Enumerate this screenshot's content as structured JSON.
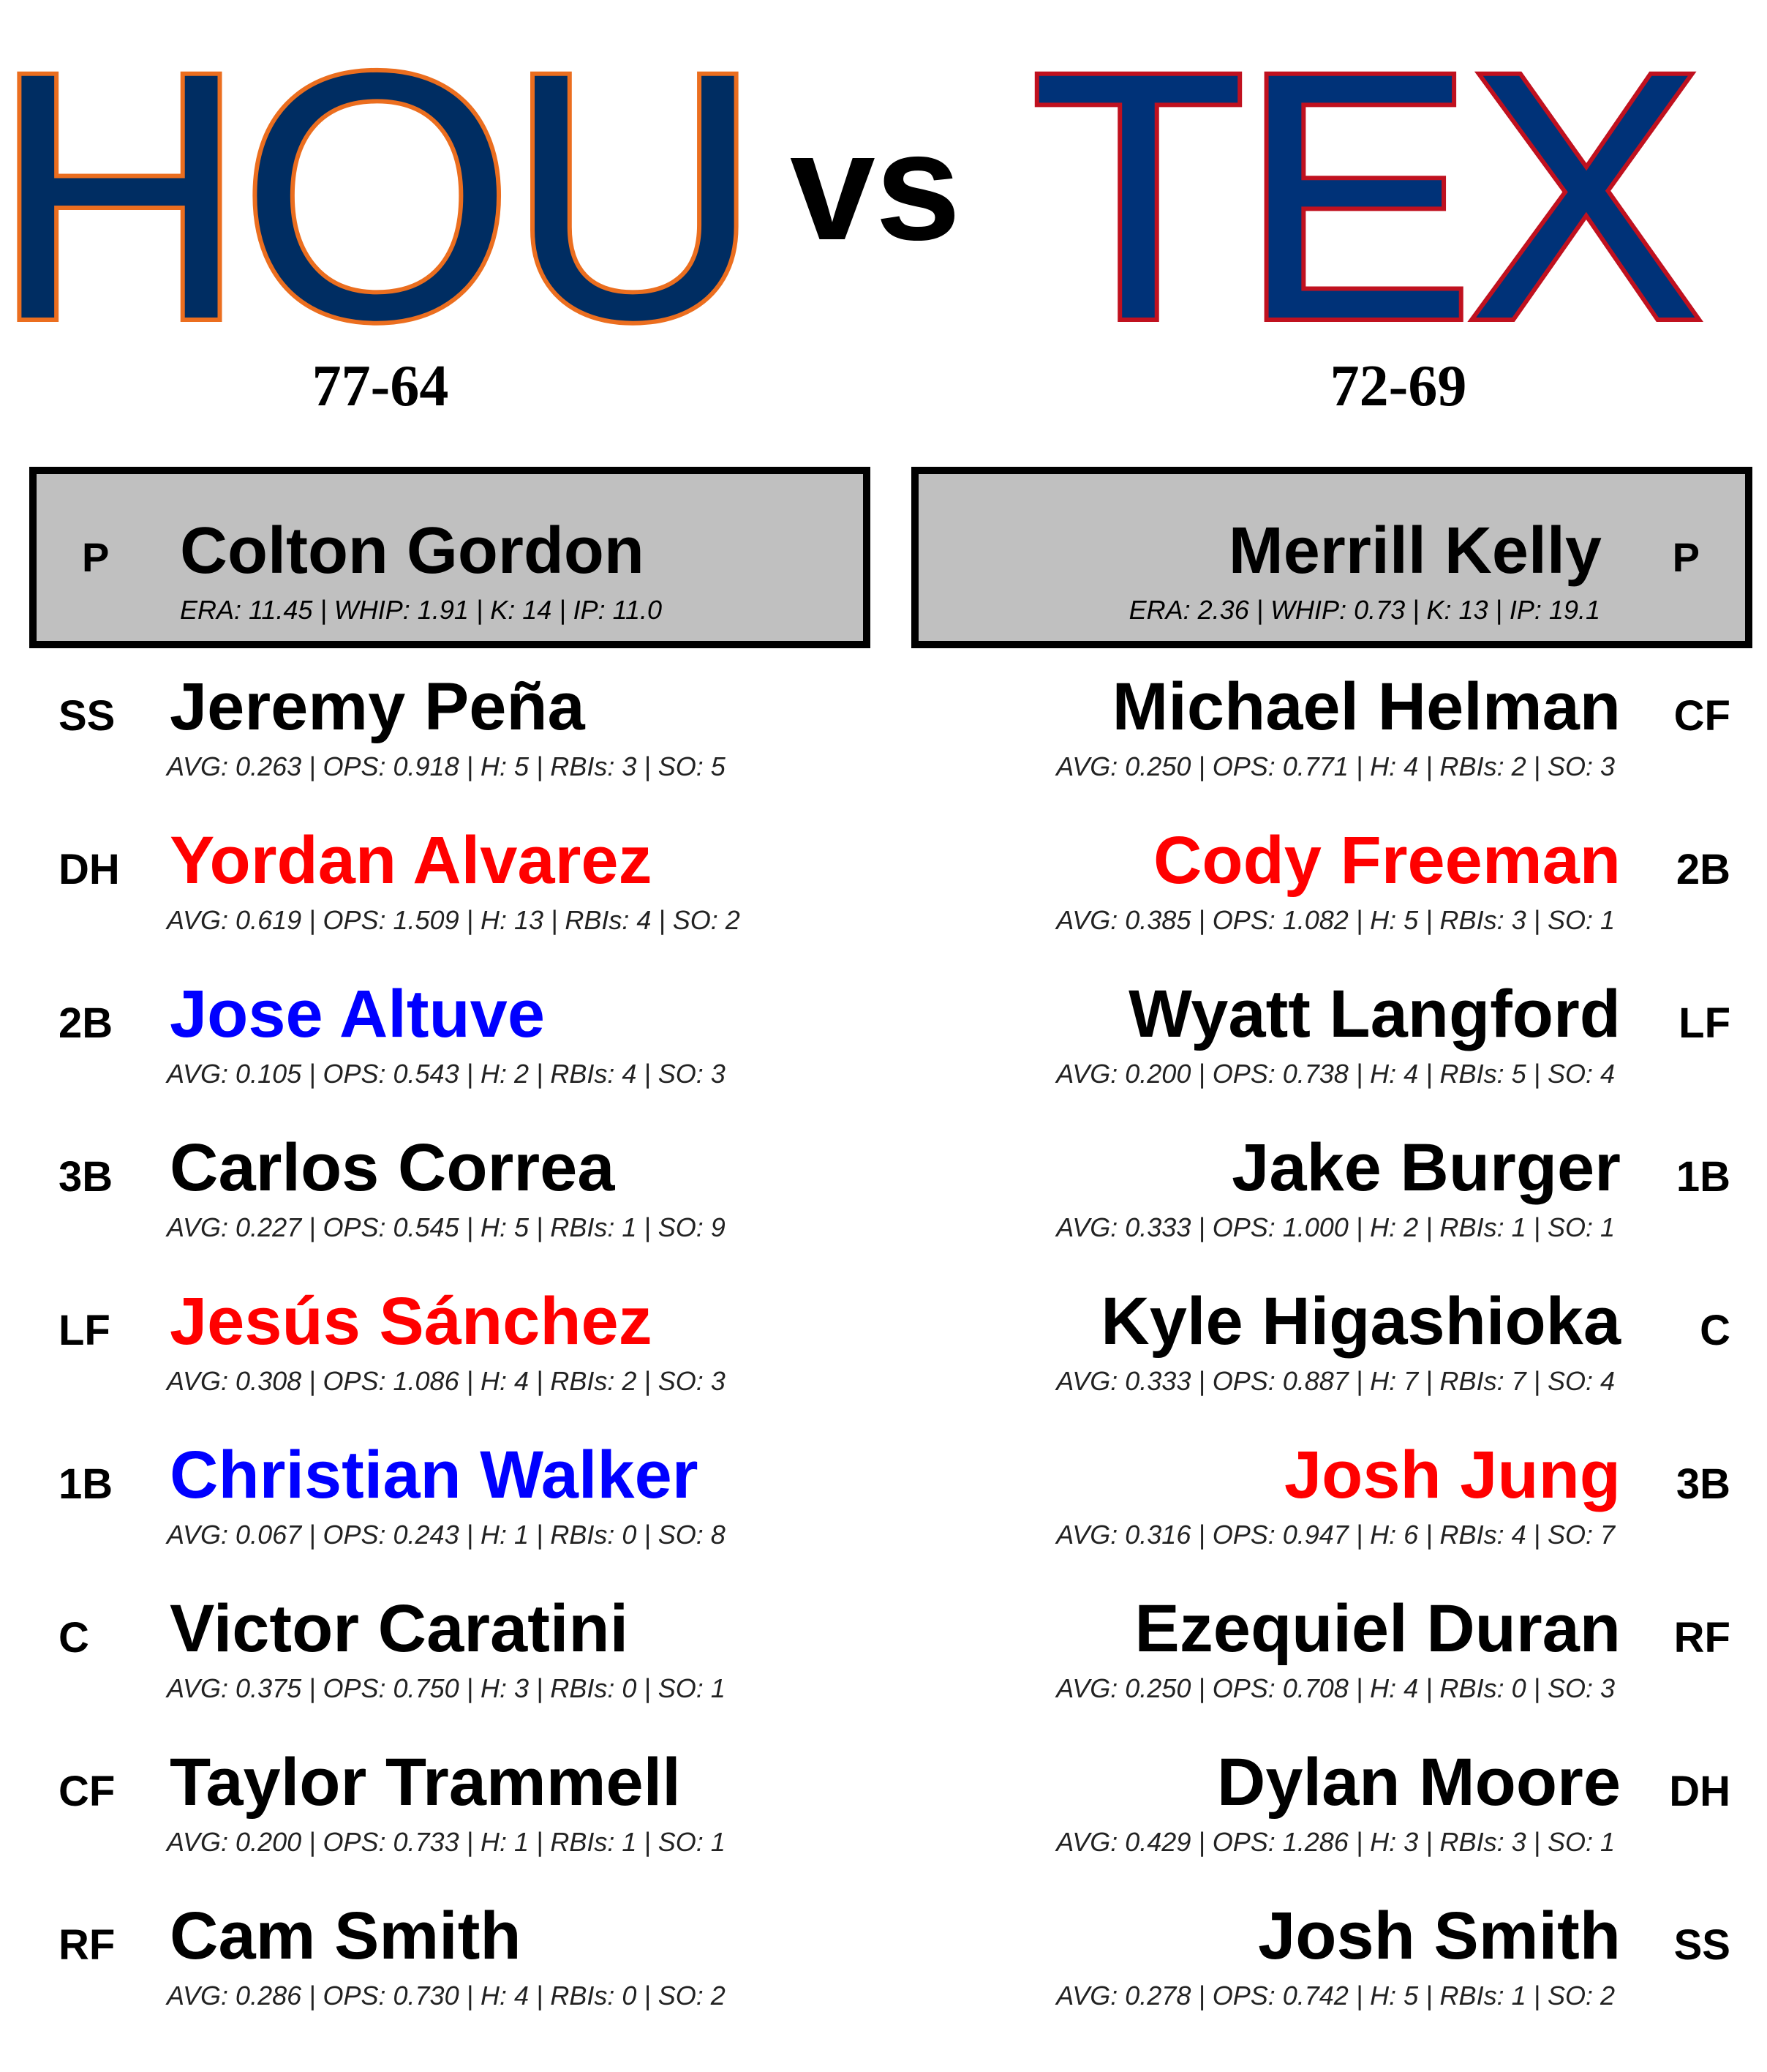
{
  "home": {
    "code": "HOU",
    "record": "77-64",
    "colors": {
      "fill": "#002D62",
      "stroke": "#EB6E1F"
    },
    "pitcher": {
      "pos": "P",
      "name": "Colton Gordon",
      "stats": "ERA: 11.45 | WHIP: 1.91 | K: 14 | IP: 11.0"
    },
    "lineup": [
      {
        "pos": "SS",
        "name": "Jeremy Peña",
        "color": "#000000",
        "stats": "AVG: 0.263 | OPS: 0.918 | H: 5 | RBIs: 3 | SO: 5"
      },
      {
        "pos": "DH",
        "name": "Yordan Alvarez",
        "color": "#ff0000",
        "stats": "AVG: 0.619 | OPS: 1.509 | H: 13 | RBIs: 4 | SO: 2"
      },
      {
        "pos": "2B",
        "name": "Jose Altuve",
        "color": "#0000ff",
        "stats": "AVG: 0.105 | OPS: 0.543 | H: 2 | RBIs: 4 | SO: 3"
      },
      {
        "pos": "3B",
        "name": "Carlos Correa",
        "color": "#000000",
        "stats": "AVG: 0.227 | OPS: 0.545 | H: 5 | RBIs: 1 | SO: 9"
      },
      {
        "pos": "LF",
        "name": "Jesús Sánchez",
        "color": "#ff0000",
        "stats": "AVG: 0.308 | OPS: 1.086 | H: 4 | RBIs: 2 | SO: 3"
      },
      {
        "pos": "1B",
        "name": "Christian Walker",
        "color": "#0000ff",
        "stats": "AVG: 0.067 | OPS: 0.243 | H: 1 | RBIs: 0 | SO: 8"
      },
      {
        "pos": "C",
        "name": "Victor Caratini",
        "color": "#000000",
        "stats": "AVG: 0.375 | OPS: 0.750 | H: 3 | RBIs: 0 | SO: 1"
      },
      {
        "pos": "CF",
        "name": "Taylor Trammell",
        "color": "#000000",
        "stats": "AVG: 0.200 | OPS: 0.733 | H: 1 | RBIs: 1 | SO: 1"
      },
      {
        "pos": "RF",
        "name": "Cam Smith",
        "color": "#000000",
        "stats": "AVG: 0.286 | OPS: 0.730 | H: 4 | RBIs: 0 | SO: 2"
      }
    ]
  },
  "vs_label": "vs",
  "away": {
    "code": "TEX",
    "record": "72-69",
    "colors": {
      "fill": "#003278",
      "stroke": "#C0111F"
    },
    "pitcher": {
      "pos": "P",
      "name": "Merrill Kelly",
      "stats": "ERA: 2.36 | WHIP: 0.73 | K: 13 | IP: 19.1"
    },
    "lineup": [
      {
        "pos": "CF",
        "name": "Michael Helman",
        "color": "#000000",
        "stats": "AVG: 0.250 | OPS: 0.771 | H: 4 | RBIs: 2 | SO: 3"
      },
      {
        "pos": "2B",
        "name": "Cody Freeman",
        "color": "#ff0000",
        "stats": "AVG: 0.385 | OPS: 1.082 | H: 5 | RBIs: 3 | SO: 1"
      },
      {
        "pos": "LF",
        "name": "Wyatt Langford",
        "color": "#000000",
        "stats": "AVG: 0.200 | OPS: 0.738 | H: 4 | RBIs: 5 | SO: 4"
      },
      {
        "pos": "1B",
        "name": "Jake Burger",
        "color": "#000000",
        "stats": "AVG: 0.333 | OPS: 1.000 | H: 2 | RBIs: 1 | SO: 1"
      },
      {
        "pos": "C",
        "name": "Kyle Higashioka",
        "color": "#000000",
        "stats": "AVG: 0.333 | OPS: 0.887 | H: 7 | RBIs: 7 | SO: 4"
      },
      {
        "pos": "3B",
        "name": "Josh Jung",
        "color": "#ff0000",
        "stats": "AVG: 0.316 | OPS: 0.947 | H: 6 | RBIs: 4 | SO: 7"
      },
      {
        "pos": "RF",
        "name": "Ezequiel Duran",
        "color": "#000000",
        "stats": "AVG: 0.250 | OPS: 0.708 | H: 4 | RBIs: 0 | SO: 3"
      },
      {
        "pos": "DH",
        "name": "Dylan Moore",
        "color": "#000000",
        "stats": "AVG: 0.429 | OPS: 1.286 | H: 3 | RBIs: 3 | SO: 1"
      },
      {
        "pos": "SS",
        "name": "Josh Smith",
        "color": "#000000",
        "stats": "AVG: 0.278 | OPS: 0.742 | H: 5 | RBIs: 1 | SO: 2"
      }
    ]
  }
}
